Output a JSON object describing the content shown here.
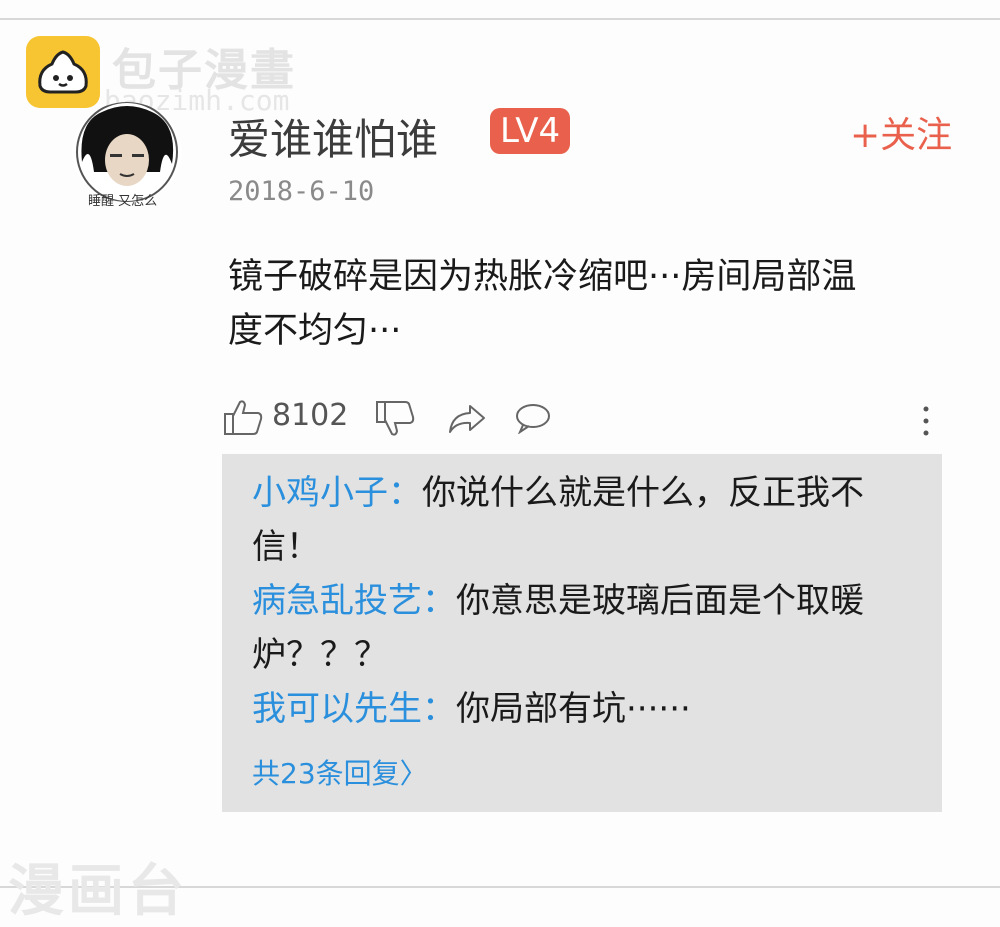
{
  "watermark": {
    "brand": "包子漫畫",
    "domain": "baozimh.com",
    "bottom": "漫画台"
  },
  "comment": {
    "avatar_caption": "睡醒 又怎么",
    "username": "爱谁谁怕谁",
    "level": "LV4",
    "follow_label": "+关注",
    "date": "2018-6-10",
    "text": "镜子破碎是因为热胀冷缩吧···房间局部温度不均匀···",
    "likes": "8102"
  },
  "replies": [
    {
      "author": "小鸡小子：",
      "text": "你说什么就是什么，反正我不信！"
    },
    {
      "author": "病急乱投艺：",
      "text": "你意思是玻璃后面是个取暖炉？？？"
    },
    {
      "author": "我可以先生：",
      "text": "你局部有坑······"
    }
  ],
  "more_replies_label": "共23条回复〉",
  "colors": {
    "accent": "#e9614c",
    "reply_author": "#2a8fdc",
    "reply_bg": "#e2e2e2"
  },
  "icons": [
    "like-icon",
    "dislike-icon",
    "share-icon",
    "reply-icon",
    "more-icon"
  ]
}
